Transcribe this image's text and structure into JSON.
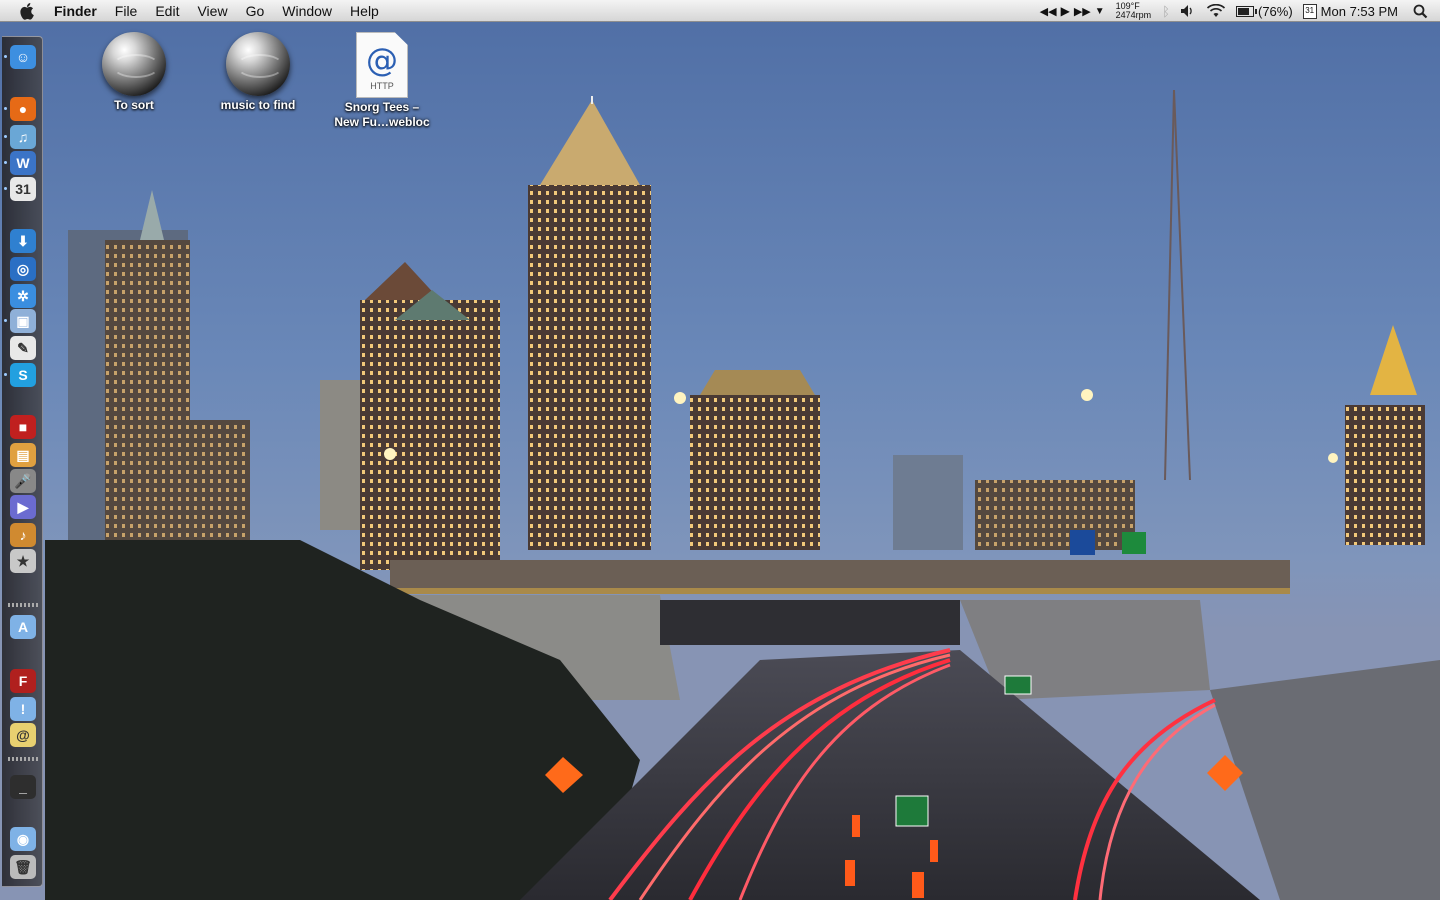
{
  "menubar": {
    "app_name": "Finder",
    "menus": [
      "File",
      "Edit",
      "View",
      "Go",
      "Window",
      "Help"
    ],
    "temperature": "109°F",
    "fan_speed": "2474rpm",
    "battery_percent": "(76%)",
    "battery_level": 0.76,
    "calendar_day": "31",
    "clock": "Mon 7:53 PM"
  },
  "desktop": {
    "icons": [
      {
        "label": "To sort",
        "type": "globe"
      },
      {
        "label": "music to find",
        "type": "globe"
      },
      {
        "label": "Snorg Tees –\nNew Fu…webloc",
        "type": "webloc",
        "badge": "HTTP",
        "glyph": "@"
      }
    ]
  },
  "dock": {
    "icons": [
      {
        "name": "finder-icon",
        "glyph": "☺",
        "color": "#3d8fe0"
      },
      {
        "name": "firefox-icon",
        "glyph": "●",
        "color": "#e66a16"
      },
      {
        "name": "itunes-icon",
        "glyph": "♫",
        "color": "#6aa7d6"
      },
      {
        "name": "word-icon",
        "glyph": "W",
        "color": "#3b74c7"
      },
      {
        "name": "ical-icon",
        "glyph": "31",
        "color": "#e8e8e8"
      },
      {
        "name": "download-icon",
        "glyph": "⬇",
        "color": "#2f80d0"
      },
      {
        "name": "network-icon",
        "glyph": "◎",
        "color": "#2a6fc4"
      },
      {
        "name": "safari-icon",
        "glyph": "✲",
        "color": "#3a8ee0"
      },
      {
        "name": "preview-icon",
        "glyph": "▣",
        "color": "#8fb0d8"
      },
      {
        "name": "textedit-icon",
        "glyph": "✎",
        "color": "#e8e8e8"
      },
      {
        "name": "skype-icon",
        "glyph": "S",
        "color": "#22a0e0"
      },
      {
        "name": "photo-booth-icon",
        "glyph": "■",
        "color": "#c0201f"
      },
      {
        "name": "iphoto-icon",
        "glyph": "▤",
        "color": "#e0a040"
      },
      {
        "name": "microphone-icon",
        "glyph": "🎤",
        "color": "#888"
      },
      {
        "name": "imovie-icon",
        "glyph": "▶",
        "color": "#6b6bd0"
      },
      {
        "name": "garageband-icon",
        "glyph": "♪",
        "color": "#d08a30"
      },
      {
        "name": "imovie-star-icon",
        "glyph": "★",
        "color": "#c8c8c8"
      },
      {
        "name": "applications-folder-icon",
        "glyph": "A",
        "color": "#7fb2e6"
      },
      {
        "name": "flash-icon",
        "glyph": "F",
        "color": "#b0201e"
      },
      {
        "name": "alert-folder-icon",
        "glyph": "!",
        "color": "#7fb2e6"
      },
      {
        "name": "mail-icon",
        "glyph": "@",
        "color": "#e8d070"
      },
      {
        "name": "terminal-icon",
        "glyph": "_",
        "color": "#2e2e2e"
      },
      {
        "name": "documents-folder-icon",
        "glyph": "◉",
        "color": "#7fb2e6"
      },
      {
        "name": "trash-icon",
        "glyph": "🗑",
        "color": "#bbb"
      }
    ]
  }
}
